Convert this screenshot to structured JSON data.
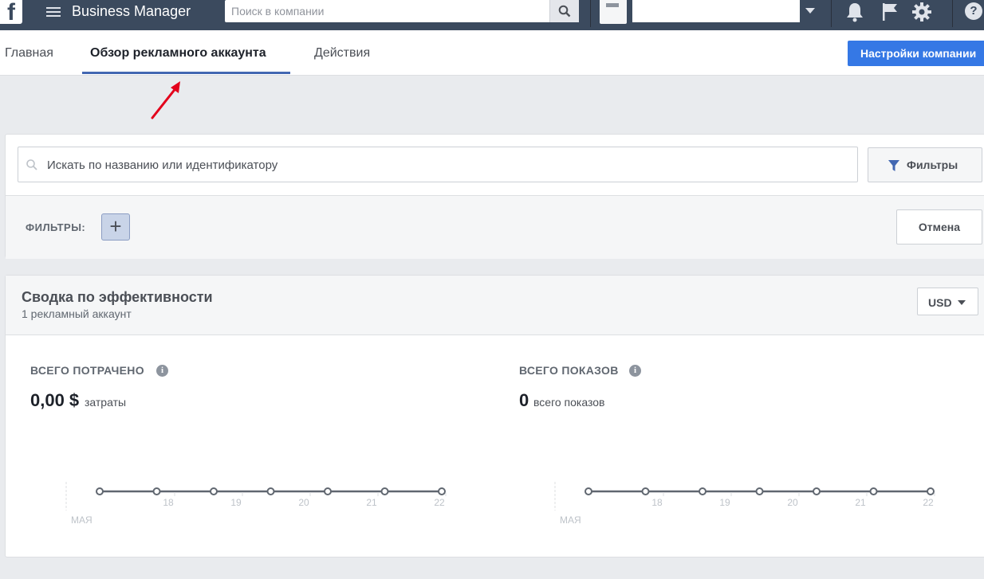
{
  "topbar": {
    "logo": "f",
    "title": "Business Manager",
    "search_placeholder": "Поиск в компании",
    "icons": [
      "menu-icon",
      "search-icon",
      "bell-icon",
      "flag-icon",
      "gear-icon",
      "help-icon"
    ],
    "help_glyph": "?"
  },
  "tabs": [
    {
      "label": "Главная",
      "active": false
    },
    {
      "label": "Обзор рекламного аккаунта",
      "active": true
    },
    {
      "label": "Действия",
      "active": false
    }
  ],
  "settings_button": "Настройки компании",
  "search_panel": {
    "placeholder": "Искать по названию или идентификатору",
    "filter_button": "Фильтры",
    "filters_label": "ФИЛЬТРЫ:",
    "add_filter": "+",
    "cancel_button": "Отмена"
  },
  "summary": {
    "title": "Сводка по эффективности",
    "subtitle": "1 рекламный аккаунт",
    "currency": "USD",
    "metrics": [
      {
        "title": "ВСЕГО ПОТРАЧЕНО",
        "value": "0,00 $",
        "unit": "затраты"
      },
      {
        "title": "ВСЕГО ПОКАЗОВ",
        "value": "0",
        "unit": "всего показов"
      }
    ]
  },
  "chart_data": [
    {
      "type": "line",
      "categories": [
        "МАЯ",
        "18",
        "19",
        "20",
        "21",
        "22"
      ],
      "values": [
        0,
        0,
        0,
        0,
        0,
        0,
        0
      ],
      "xlabel": "МАЯ"
    },
    {
      "type": "line",
      "categories": [
        "МАЯ",
        "18",
        "19",
        "20",
        "21",
        "22"
      ],
      "values": [
        0,
        0,
        0,
        0,
        0,
        0,
        0
      ],
      "xlabel": "МАЯ"
    }
  ],
  "colors": {
    "topbar": "#3b4a5e",
    "accent": "#4267b2",
    "button_blue": "#3578e5",
    "arrow": "#e3001b"
  }
}
